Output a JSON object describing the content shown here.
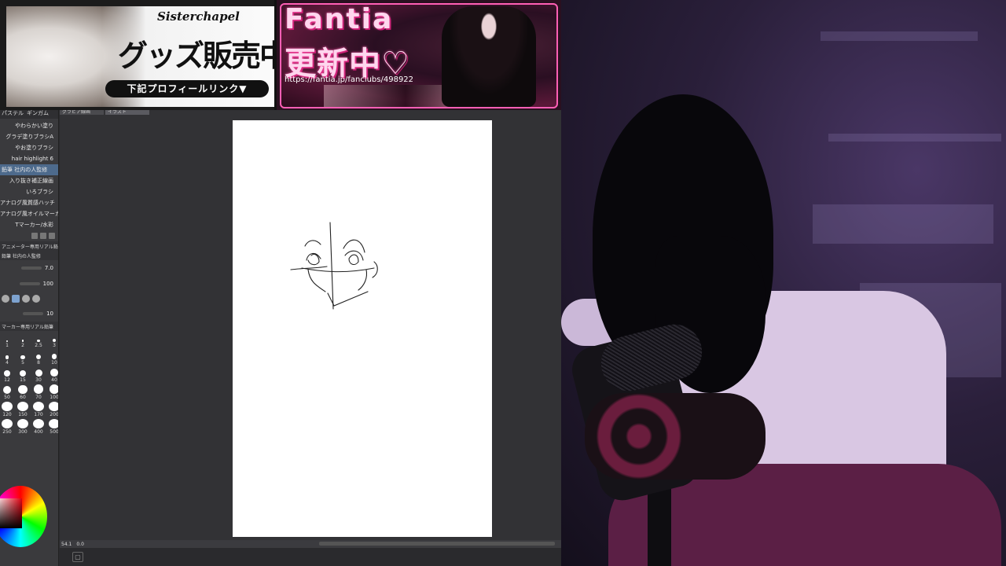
{
  "banner_goods": {
    "logo": "Sisterchapel",
    "title": "グッズ販売中",
    "pill": "下記プロフィールリンク▼"
  },
  "banner_fantia": {
    "title": "Fantia",
    "subtitle": "更新中♡",
    "url": "https://fantia.jp/fanclubs/498922"
  },
  "tool_panel": {
    "tabs": [
      "パステル",
      "ギンガム"
    ],
    "brushes": [
      "やわらかい塗り",
      "グラデ塗りブラシA",
      "やお塗りブラシ",
      "hair highlight 6",
      "鉛筆 社内の人監修",
      "入り抜き補正線画",
      "いろブラシ",
      "アナログ風質感ハッチ",
      "アナログ風オイルマーカー",
      "Tマーカー/水彩"
    ],
    "selected_brush_index": 4,
    "sub_tool_header": "アニメーター専用リアル鉛筆",
    "sub_tool_name": "鉛筆 社内の人監修",
    "brush_size": "7.0",
    "opacity": "100",
    "stabilization": "10",
    "size_header": "マーカー専用リアル鉛筆",
    "sizes": [
      "1",
      "2",
      "2.5",
      "3",
      "4",
      "5",
      "8",
      "10",
      "12",
      "15",
      "30",
      "40",
      "50",
      "60",
      "70",
      "100",
      "120",
      "150",
      "170",
      "200",
      "250",
      "300",
      "400",
      "500",
      "600",
      "700",
      "800"
    ]
  },
  "canvas": {
    "tab1": "グラビア線画",
    "tab2": "イラスト"
  },
  "status_bar": {
    "zoom": "54.1",
    "angle": "0.0"
  },
  "colors": {
    "accent": "#4d6a8c",
    "fantia_pink": "#ff5fb5",
    "panel_bg": "#3a3a3d"
  }
}
